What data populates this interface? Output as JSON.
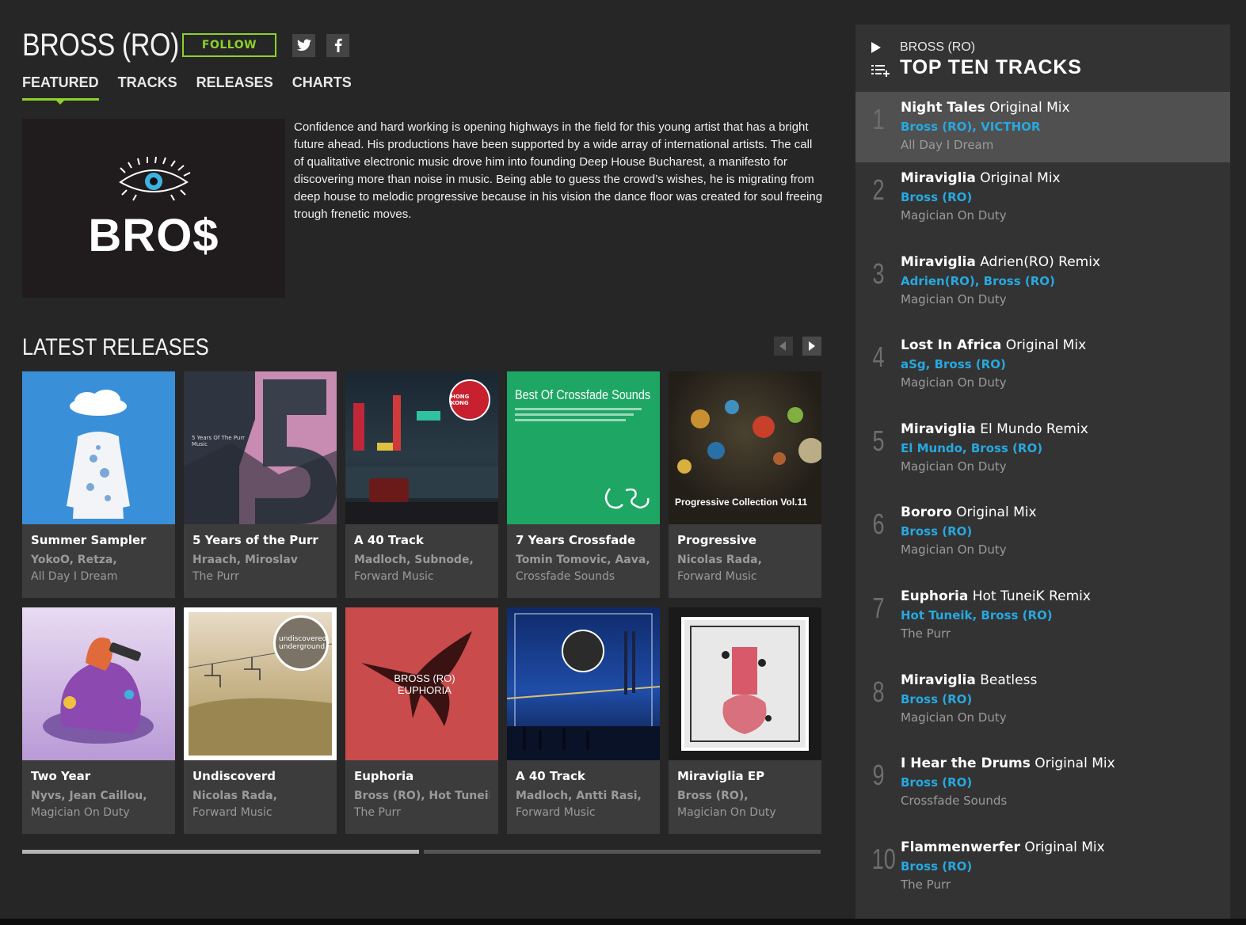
{
  "artist": {
    "name": "BROSS (RO)",
    "follow_label": "FOLLOW",
    "logo_text": "BRO$",
    "bio": "Confidence and hard working is opening highways in the field for this young artist that has a bright future ahead. His productions have been supported by a wide array of international artists. The call of qualitative electronic music drove him into founding Deep House Bucharest, a manifesto for discovering more than noise in music. Being able to guess the crowd’s wishes, he is migrating from deep house to melodic progressive because in his vision the dance floor was created for soul freeing trough frenetic moves."
  },
  "tabs": [
    {
      "label": "FEATURED",
      "active": true
    },
    {
      "label": "TRACKS",
      "active": false
    },
    {
      "label": "RELEASES",
      "active": false
    },
    {
      "label": "CHARTS",
      "active": false
    }
  ],
  "latest_releases": {
    "title": "LATEST RELEASES",
    "items": [
      {
        "title": "Summer Sampler",
        "artists": "YokoO, Retza,",
        "label": "All Day I Dream",
        "art_text": ""
      },
      {
        "title": "5 Years of the Purr",
        "artists": "Hraach, Miroslav",
        "label": "The Purr",
        "art_text": "5 Years Of The Purr Music"
      },
      {
        "title": "A 40 Track",
        "artists": "Madloch, Subnode,",
        "label": "Forward Music",
        "art_text": "HONG KONG"
      },
      {
        "title": "7 Years Crossfade",
        "artists": "Tomin Tomovic, Aava,",
        "label": "Crossfade Sounds",
        "art_text": "Best Of Crossfade Sounds"
      },
      {
        "title": "Progressive",
        "artists": "Nicolas Rada,",
        "label": "Forward Music",
        "art_text": "Progressive Collection Vol.11"
      },
      {
        "title": "Two Year",
        "artists": "Nyvs, Jean Caillou,",
        "label": "Magician On Duty",
        "art_text": ""
      },
      {
        "title": "Undiscoverd",
        "artists": "Nicolas Rada,",
        "label": "Forward Music",
        "art_text": "undiscovered underground"
      },
      {
        "title": "Euphoria",
        "artists": "Bross (RO), Hot Tuneik",
        "label": "The Purr",
        "art_text": "BROSS (RO) EUPHORIA"
      },
      {
        "title": "A 40 Track",
        "artists": "Madloch, Antti Rasi,",
        "label": "Forward Music",
        "art_text": ""
      },
      {
        "title": "Miraviglia EP",
        "artists": "Bross (RO),",
        "label": "Magician On Duty",
        "art_text": ""
      }
    ]
  },
  "top_ten": {
    "artist": "BROSS (RO)",
    "title": "TOP TEN TRACKS",
    "tracks": [
      {
        "num": "1",
        "name": "Night Tales",
        "mix": "Original Mix",
        "artists": "Bross (RO), VICTHOR",
        "label": "All Day I Dream"
      },
      {
        "num": "2",
        "name": "Miraviglia",
        "mix": "Original Mix",
        "artists": "Bross (RO)",
        "label": "Magician On Duty"
      },
      {
        "num": "3",
        "name": "Miraviglia",
        "mix": "Adrien(RO) Remix",
        "artists": "Adrien(RO), Bross (RO)",
        "label": "Magician On Duty"
      },
      {
        "num": "4",
        "name": "Lost In Africa",
        "mix": "Original Mix",
        "artists": "aSg, Bross (RO)",
        "label": "Magician On Duty"
      },
      {
        "num": "5",
        "name": "Miraviglia",
        "mix": "El Mundo Remix",
        "artists": "El Mundo, Bross (RO)",
        "label": "Magician On Duty"
      },
      {
        "num": "6",
        "name": "Bororo",
        "mix": "Original Mix",
        "artists": "Bross (RO)",
        "label": "Magician On Duty"
      },
      {
        "num": "7",
        "name": "Euphoria",
        "mix": "Hot TuneiK Remix",
        "artists": "Hot Tuneik, Bross (RO)",
        "label": "The Purr"
      },
      {
        "num": "8",
        "name": "Miraviglia",
        "mix": "Beatless",
        "artists": "Bross (RO)",
        "label": "Magician On Duty"
      },
      {
        "num": "9",
        "name": "I Hear the Drums",
        "mix": "Original Mix",
        "artists": "Bross (RO)",
        "label": "Crossfade Sounds"
      },
      {
        "num": "10",
        "name": "Flammenwerfer",
        "mix": "Original Mix",
        "artists": "Bross (RO)",
        "label": "The Purr"
      }
    ]
  },
  "carousel": {
    "page": 1,
    "pages": 2
  },
  "colors": {
    "accent": "#8cd12a",
    "link": "#27a8e0",
    "bg": "#262626",
    "sidebar": "#333333"
  }
}
